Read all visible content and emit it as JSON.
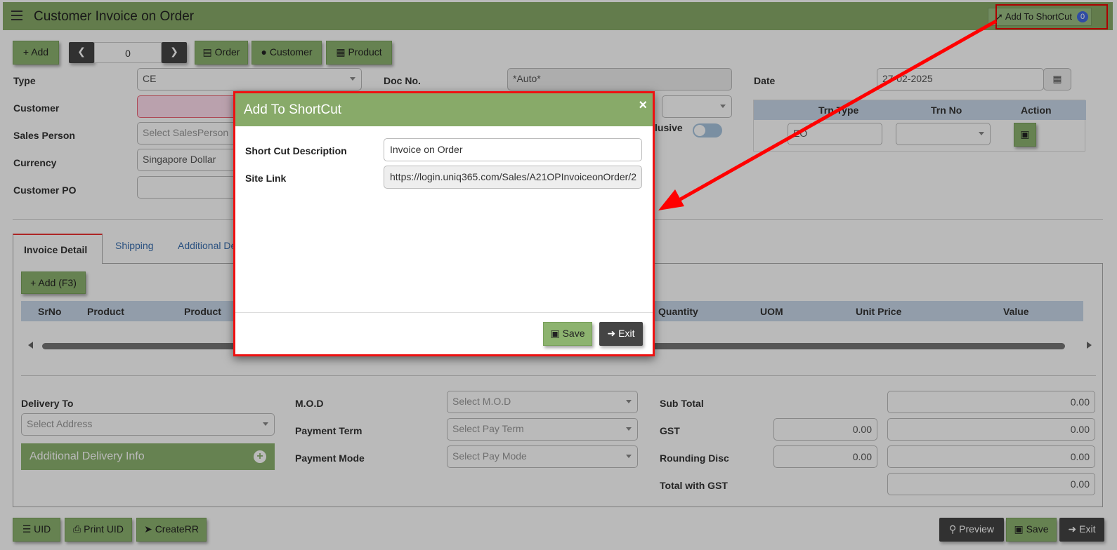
{
  "header": {
    "title": "Customer Invoice on Order",
    "shortcut_label": "Add To ShortCut",
    "shortcut_count": "0"
  },
  "toolbar": {
    "add_label": "Add",
    "nav_value": "0",
    "order_label": "Order",
    "customer_label": "Customer",
    "product_label": "Product"
  },
  "form": {
    "type_label": "Type",
    "type_value": "CE",
    "docno_label": "Doc No.",
    "docno_value": "*Auto*",
    "date_label": "Date",
    "date_value": "27-02-2025",
    "customer_label": "Customer",
    "salesperson_label": "Sales Person",
    "salesperson_placeholder": "Select SalesPerson",
    "currency_label": "Currency",
    "currency_value": "Singapore Dollar",
    "customerpo_label": "Customer PO",
    "inclusive_label": "lusive"
  },
  "trn_table": {
    "col1": "Trn Type",
    "col2": "Trn No",
    "col3": "Action",
    "trn_type_value": "EO"
  },
  "tabs": {
    "invoice_detail": "Invoice Detail",
    "shipping": "Shipping",
    "additional": "Additional De"
  },
  "detail": {
    "add_label": "Add (F3)",
    "columns": [
      "SrNo",
      "Product",
      "Product",
      "Quantity",
      "UOM",
      "Unit Price",
      "Value"
    ]
  },
  "bottom": {
    "delivery_to_label": "Delivery To",
    "address_placeholder": "Select Address",
    "additional_delivery_label": "Additional Delivery Info",
    "mod_label": "M.O.D",
    "mod_placeholder": "Select M.O.D",
    "payterm_label": "Payment Term",
    "payterm_placeholder": "Select Pay Term",
    "paymode_label": "Payment Mode",
    "paymode_placeholder": "Select Pay Mode",
    "subtotal_label": "Sub Total",
    "subtotal_value": "0.00",
    "gst_label": "GST",
    "gst_rate": "0.00",
    "gst_value": "0.00",
    "rounding_label": "Rounding Disc",
    "rounding_rate": "0.00",
    "rounding_value": "0.00",
    "total_label": "Total with GST",
    "total_value": "0.00"
  },
  "footer": {
    "uid_label": "UID",
    "print_uid_label": "Print UID",
    "create_rr_label": "CreateRR",
    "preview_label": "Preview",
    "save_label": "Save",
    "exit_label": "Exit"
  },
  "modal": {
    "title": "Add To ShortCut",
    "close": "×",
    "desc_label": "Short Cut Description",
    "desc_value": "Invoice on Order",
    "link_label": "Site Link",
    "link_value": "https://login.uniq365.com/Sales/A21OPInvoiceonOrder/2",
    "save_label": "Save",
    "exit_label": "Exit"
  },
  "colors": {
    "header_green": "#88aa69",
    "highlight_red": "#e00000",
    "table_head_blue": "#c9d8ea"
  }
}
